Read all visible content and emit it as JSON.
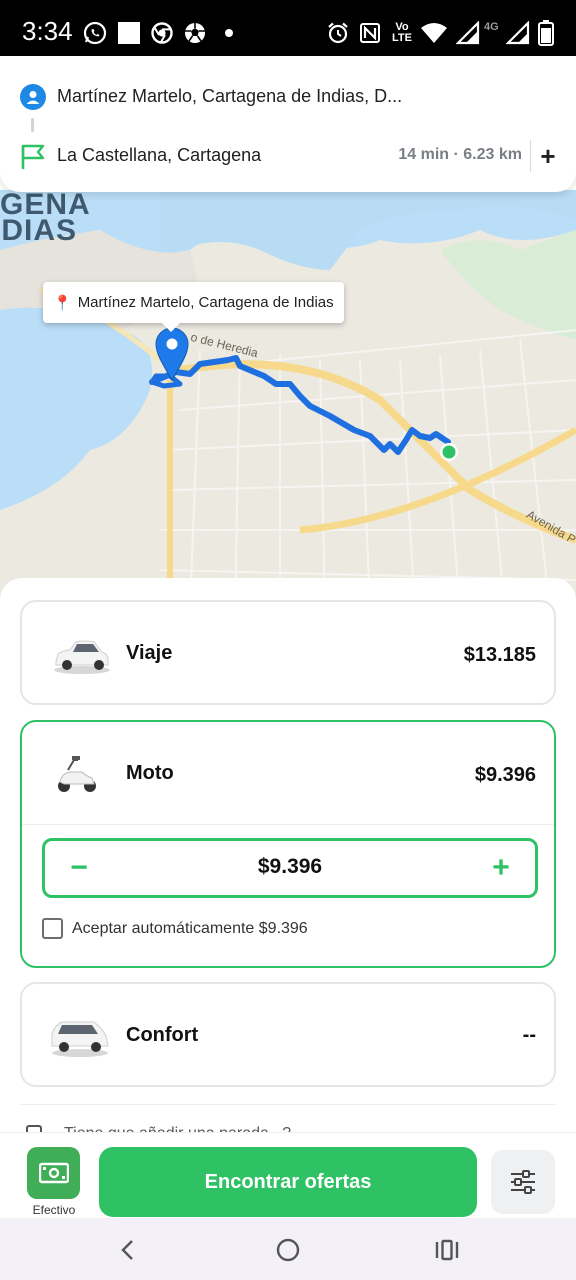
{
  "status_bar": {
    "time": "3:34",
    "network_badge": "4G",
    "volte_badge": "Vo\nLTE",
    "icons": [
      "whatsapp-icon",
      "square-icon",
      "chrome-icon",
      "soccer-ball-icon",
      "dot-icon",
      "alarm-icon",
      "nfc-icon",
      "volte-icon",
      "wifi-icon",
      "signal-icon",
      "signal-4g-icon",
      "battery-icon"
    ]
  },
  "route": {
    "origin": "Martínez Martelo, Cartagena de Indias, D...",
    "destination": "La Castellana, Cartagena",
    "eta": "14 min · 6.23 km",
    "add_stop_label": "+"
  },
  "map": {
    "city_label_line1": "GENA",
    "city_label_line2": "IDIAS",
    "street_label_1": "o de Heredia",
    "street_label_2": "Avenida P",
    "pickup_tooltip": "Martínez Martelo, Cartagena de Indias",
    "route_color": "#1e6fe0",
    "destination_dot_color": "#2ec264"
  },
  "options": [
    {
      "name": "Viaje",
      "price": "$13.185",
      "icon": "car-icon"
    },
    {
      "name": "Moto",
      "price": "$9.396",
      "icon": "scooter-icon",
      "selected": true
    },
    {
      "name": "Confort",
      "price": "--",
      "icon": "minivan-icon"
    }
  ],
  "moto_stepper": {
    "minus_label": "−",
    "value": "$9.396",
    "plus_label": "+",
    "auto_accept_label": "Aceptar automáticamente $9.396",
    "auto_accept_checked": false
  },
  "peek_text": "Tiene que añadir una parada...?",
  "action_bar": {
    "payment_label": "Efectivo",
    "find_offers_label": "Encontrar ofertas"
  },
  "colors": {
    "accent_green": "#2ec264",
    "route_blue": "#1e6fe0",
    "origin_blue": "#1e88e5"
  }
}
